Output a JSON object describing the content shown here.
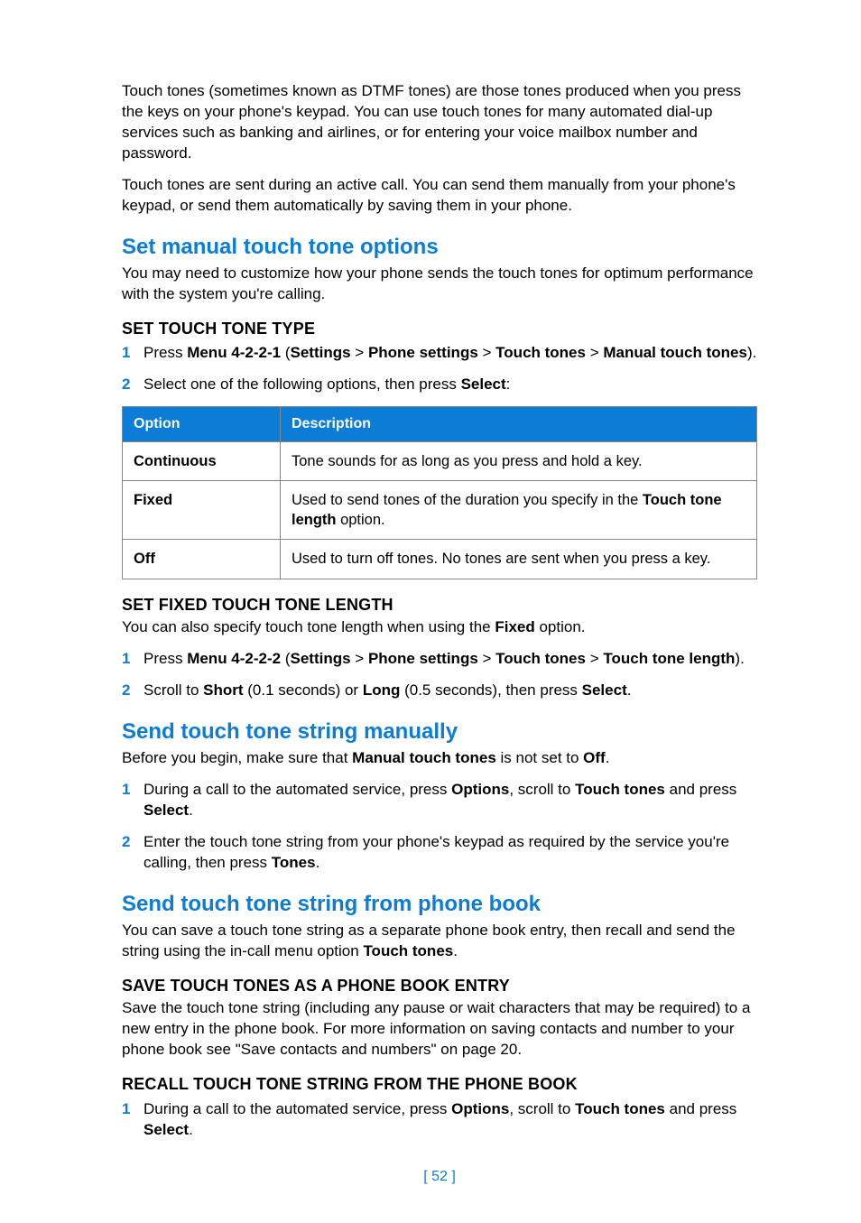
{
  "intro": {
    "p1": "Touch tones (sometimes known as DTMF tones) are those tones produced when you press the keys on your phone's keypad. You can use touch tones for many automated dial-up services such as banking and airlines, or for entering your voice mailbox number and password.",
    "p2": "Touch tones are sent during an active call. You can send them manually from your phone's keypad, or send them automatically by saving them in your phone."
  },
  "sec1": {
    "title": "Set manual touch tone options",
    "lead": "You may need to customize how your phone sends the touch tones for optimum performance with the system you're calling.",
    "sub1": {
      "title": "SET TOUCH TONE TYPE",
      "step1_a": "Press ",
      "step1_b": "Menu 4-2-2-1",
      "step1_c": " (",
      "step1_d": "Settings",
      "step1_e": " > ",
      "step1_f": "Phone settings",
      "step1_g": " > ",
      "step1_h": "Touch tones",
      "step1_i": " > ",
      "step1_j": "Manual touch tones",
      "step1_k": ").",
      "step2_a": "Select one of the following options, then press ",
      "step2_b": "Select",
      "step2_c": ":"
    },
    "table": {
      "h1": "Option",
      "h2": "Description",
      "r1c1": "Continuous",
      "r1c2": "Tone sounds for as long as you press and hold a key.",
      "r2c1": "Fixed",
      "r2c2a": "Used to send tones of the duration you specify in the ",
      "r2c2b": "Touch tone length",
      "r2c2c": " option.",
      "r3c1": "Off",
      "r3c2": "Used to turn off tones. No tones are sent when you press a key."
    },
    "sub2": {
      "title": "SET FIXED TOUCH TONE LENGTH",
      "lead_a": "You can also specify touch tone length when using the ",
      "lead_b": "Fixed",
      "lead_c": " option.",
      "step1_a": "Press ",
      "step1_b": "Menu 4-2-2-2",
      "step1_c": " (",
      "step1_d": "Settings",
      "step1_e": " > ",
      "step1_f": "Phone settings",
      "step1_g": " > ",
      "step1_h": "Touch tones",
      "step1_i": " > ",
      "step1_j": "Touch tone length",
      "step1_k": ").",
      "step2_a": "Scroll to ",
      "step2_b": "Short",
      "step2_c": " (0.1 seconds) or ",
      "step2_d": "Long",
      "step2_e": " (0.5 seconds), then press ",
      "step2_f": "Select",
      "step2_g": "."
    }
  },
  "sec2": {
    "title": "Send touch tone string manually",
    "lead_a": "Before you begin, make sure that ",
    "lead_b": "Manual touch tones",
    "lead_c": " is not set to ",
    "lead_d": "Off",
    "lead_e": ".",
    "step1_a": "During a call to the automated service, press ",
    "step1_b": "Options",
    "step1_c": ", scroll to ",
    "step1_d": "Touch tones",
    "step1_e": " and press ",
    "step1_f": "Select",
    "step1_g": ".",
    "step2_a": "Enter the touch tone string from your phone's keypad as required by the service you're calling, then press ",
    "step2_b": "Tones",
    "step2_c": "."
  },
  "sec3": {
    "title": "Send touch tone string from phone book",
    "lead_a": "You can save a touch tone string as a separate phone book entry, then recall and send the string using the in-call menu option ",
    "lead_b": "Touch tones",
    "lead_c": ".",
    "sub1": {
      "title": "SAVE TOUCH TONES AS A PHONE BOOK ENTRY",
      "body": "Save the touch tone string (including any pause or wait characters that may be required) to a new entry in the phone book. For more information on saving contacts and number to your phone book see \"Save contacts and numbers\" on page 20."
    },
    "sub2": {
      "title": "RECALL TOUCH TONE STRING FROM THE PHONE BOOK",
      "step1_a": "During a call to the automated service, press ",
      "step1_b": "Options",
      "step1_c": ", scroll to ",
      "step1_d": "Touch tones",
      "step1_e": " and press ",
      "step1_f": "Select",
      "step1_g": "."
    }
  },
  "pagenum": "[ 52 ]",
  "nums": {
    "n1": "1",
    "n2": "2"
  }
}
